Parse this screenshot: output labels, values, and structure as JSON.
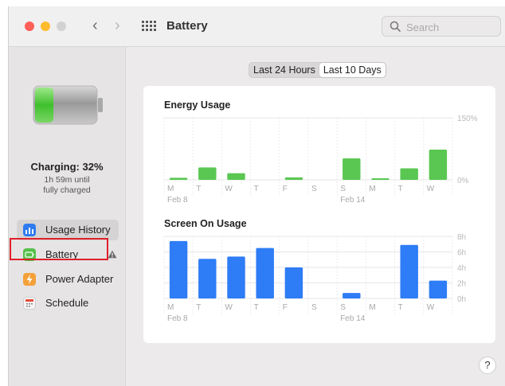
{
  "window": {
    "title": "Battery"
  },
  "search": {
    "placeholder": "Search"
  },
  "battery_status": {
    "title": "Charging: 32%",
    "line1": "1h 59m until",
    "line2": "fully charged",
    "level": 0.32
  },
  "sidebar": {
    "items": [
      {
        "label": "Usage History",
        "icon": "bar-chart-icon",
        "selected": true
      },
      {
        "label": "Battery",
        "icon": "battery-icon",
        "warning": true
      },
      {
        "label": "Power Adapter",
        "icon": "lightning-icon"
      },
      {
        "label": "Schedule",
        "icon": "calendar-icon"
      }
    ]
  },
  "range": {
    "options": [
      "Last 24 Hours",
      "Last 10 Days"
    ],
    "selected": "Last 10 Days"
  },
  "colors": {
    "green": "#5ac752",
    "blue": "#2e7cf6",
    "accent_red": "#e0202a"
  },
  "chart_data": [
    {
      "type": "bar",
      "title": "Energy Usage",
      "categories": [
        "M",
        "T",
        "W",
        "T",
        "F",
        "S",
        "S",
        "M",
        "T",
        "W"
      ],
      "date_labels": {
        "0": "Feb 8",
        "6": "Feb 14"
      },
      "values": [
        5,
        30,
        16,
        0,
        6,
        0,
        52,
        1,
        28,
        73
      ],
      "y_ticks": [
        "0%",
        "150%"
      ],
      "ylim": [
        0,
        150
      ],
      "color": "#5ac752"
    },
    {
      "type": "bar",
      "title": "Screen On Usage",
      "categories": [
        "M",
        "T",
        "W",
        "T",
        "F",
        "S",
        "S",
        "M",
        "T",
        "W"
      ],
      "date_labels": {
        "0": "Feb 8",
        "6": "Feb 14"
      },
      "values": [
        7.4,
        5.1,
        5.4,
        6.5,
        4.0,
        0,
        0.7,
        0,
        6.9,
        2.3
      ],
      "y_ticks": [
        "0h",
        "2h",
        "4h",
        "6h",
        "8h"
      ],
      "ylim": [
        0,
        8
      ],
      "color": "#2e7cf6"
    }
  ]
}
